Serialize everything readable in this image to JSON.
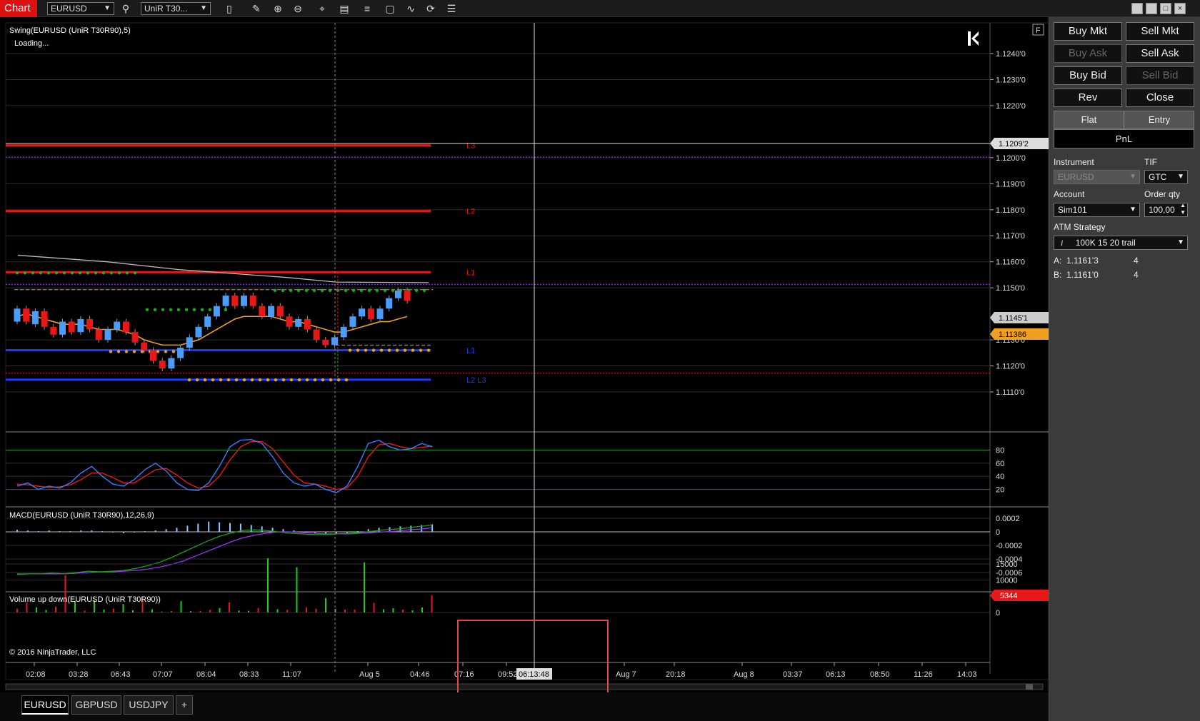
{
  "app": {
    "title": "Chart"
  },
  "toolbar": {
    "instrument": "EURUSD",
    "bar_type": "UniR T30..."
  },
  "window_controls": [
    "minimize-icon",
    "restore-icon",
    "maximize-icon",
    "close-icon"
  ],
  "indicators": {
    "swing": "Swing(EURUSD (UniR T30R90),5)",
    "loading": "Loading...",
    "macd": "MACD(EURUSD (UniR T30R90),12,26,9)",
    "volume": "Volume up down(EURUSD (UniR T30R90))",
    "copyright": "© 2016 NinjaTrader, LLC",
    "f_button": "F"
  },
  "price_axis": {
    "ticks": [
      "1.1240'0",
      "1.1230'0",
      "1.1220'0",
      "1.1200'0",
      "1.1190'0",
      "1.1180'0",
      "1.1170'0",
      "1.1160'0",
      "1.1150'0",
      "1.1130'0",
      "1.1120'0",
      "1.1110'0"
    ],
    "marker_crosshair": "1.1209'2",
    "marker_last": "1.1145'1",
    "marker_ma": "1.11386"
  },
  "level_labels": {
    "l3": "L3",
    "l2": "L2",
    "l1": "L1",
    "l1_low": "L1",
    "l2l3_low": "L2 L3"
  },
  "stoch_axis": [
    "80",
    "60",
    "40",
    "20"
  ],
  "macd_axis": [
    "0.0002",
    "0",
    "-0.0002",
    "-0.0004",
    "-0.0006"
  ],
  "volume_axis": [
    "15000",
    "10000",
    "0"
  ],
  "volume_marker": "5344",
  "time_axis": [
    "02:08",
    "03:28",
    "06:43",
    "07:07",
    "08:04",
    "08:33",
    "11:07",
    "Aug 5",
    "04:46",
    "07:16",
    "09:52",
    "06:13:48",
    "Aug 7",
    "20:18",
    "Aug 8",
    "03:37",
    "06:13",
    "08:50",
    "11:26",
    "14:03"
  ],
  "tabs": [
    "EURUSD",
    "GBPUSD",
    "USDJPY",
    "+"
  ],
  "colors": {
    "bull": "#4a9cff",
    "bear": "#e81818",
    "accent_red": "#d11",
    "ma": "#f0a020",
    "grid": "#333"
  },
  "order_panel": {
    "buy_mkt": "Buy Mkt",
    "sell_mkt": "Sell Mkt",
    "buy_ask": "Buy Ask",
    "sell_ask": "Sell Ask",
    "buy_bid": "Buy Bid",
    "sell_bid": "Sell Bid",
    "rev": "Rev",
    "close": "Close",
    "flat": "Flat",
    "entry": "Entry",
    "pnl": "PnL",
    "instrument_label": "Instrument",
    "instrument_value": "EURUSD",
    "tif_label": "TIF",
    "tif_value": "GTC",
    "account_label": "Account",
    "account_value": "Sim101",
    "order_qty_label": "Order qty",
    "order_qty_value": "100,00",
    "atm_label": "ATM Strategy",
    "atm_value": "100K 15 20 trail",
    "ask_label": "A:",
    "ask_price": "1.1161'3",
    "ask_size": "4",
    "bid_label": "B:",
    "bid_price": "1.1161'0",
    "bid_size": "4"
  },
  "chart_data": {
    "type": "candlestick",
    "candles": [
      {
        "o": 1.1137,
        "c": 1.1142
      },
      {
        "o": 1.1142,
        "c": 1.1137
      },
      {
        "o": 1.1136,
        "c": 1.1141
      },
      {
        "o": 1.1141,
        "c": 1.1135
      },
      {
        "o": 1.1135,
        "c": 1.1132
      },
      {
        "o": 1.1132,
        "c": 1.1137
      },
      {
        "o": 1.1137,
        "c": 1.1133
      },
      {
        "o": 1.1133,
        "c": 1.1138
      },
      {
        "o": 1.1138,
        "c": 1.1134
      },
      {
        "o": 1.1134,
        "c": 1.113
      },
      {
        "o": 1.113,
        "c": 1.1134
      },
      {
        "o": 1.1134,
        "c": 1.1137
      },
      {
        "o": 1.1137,
        "c": 1.1133
      },
      {
        "o": 1.1133,
        "c": 1.1129
      },
      {
        "o": 1.1129,
        "c": 1.1126
      },
      {
        "o": 1.1126,
        "c": 1.1122
      },
      {
        "o": 1.1122,
        "c": 1.1119
      },
      {
        "o": 1.1119,
        "c": 1.1123
      },
      {
        "o": 1.1123,
        "c": 1.1127
      },
      {
        "o": 1.1127,
        "c": 1.1131
      },
      {
        "o": 1.1131,
        "c": 1.1135
      },
      {
        "o": 1.1135,
        "c": 1.1139
      },
      {
        "o": 1.1139,
        "c": 1.1143
      },
      {
        "o": 1.1143,
        "c": 1.1147
      },
      {
        "o": 1.1147,
        "c": 1.1143
      },
      {
        "o": 1.1143,
        "c": 1.1147
      },
      {
        "o": 1.1147,
        "c": 1.1143
      },
      {
        "o": 1.1143,
        "c": 1.1139
      },
      {
        "o": 1.1139,
        "c": 1.1143
      },
      {
        "o": 1.1143,
        "c": 1.1139
      },
      {
        "o": 1.1139,
        "c": 1.1135
      },
      {
        "o": 1.1135,
        "c": 1.1138
      },
      {
        "o": 1.1138,
        "c": 1.1134
      },
      {
        "o": 1.1134,
        "c": 1.113
      },
      {
        "o": 1.113,
        "c": 1.1128
      },
      {
        "o": 1.1128,
        "c": 1.1131
      },
      {
        "o": 1.1131,
        "c": 1.1135
      },
      {
        "o": 1.1135,
        "c": 1.1139
      },
      {
        "o": 1.1139,
        "c": 1.1142
      },
      {
        "o": 1.1142,
        "c": 1.1138
      },
      {
        "o": 1.1138,
        "c": 1.1142
      },
      {
        "o": 1.1142,
        "c": 1.1146
      },
      {
        "o": 1.1146,
        "c": 1.1149
      },
      {
        "o": 1.1149,
        "c": 1.1145
      }
    ],
    "ma": [
      1.1139,
      1.114,
      1.1139,
      1.1138,
      1.1137,
      1.1136,
      1.1136,
      1.1136,
      1.1135,
      1.1134,
      1.1134,
      1.1134,
      1.1133,
      1.1132,
      1.113,
      1.1129,
      1.1128,
      1.1128,
      1.1128,
      1.1129,
      1.113,
      1.1132,
      1.1134,
      1.1136,
      1.1138,
      1.1139,
      1.1139,
      1.1139,
      1.1139,
      1.1138,
      1.1137,
      1.1137,
      1.1136,
      1.1135,
      1.1134,
      1.1133,
      1.1133,
      1.1134,
      1.1135,
      1.1136,
      1.1137,
      1.1137,
      1.1138,
      1.1139
    ],
    "levels": {
      "L3": 1.12047,
      "L2": 1.11795,
      "L1": 1.1156,
      "L1_low": 1.1126,
      "L2L3_low": 1.11147
    },
    "stoch_k": [
      25,
      30,
      20,
      25,
      22,
      30,
      45,
      55,
      40,
      28,
      25,
      35,
      50,
      60,
      48,
      30,
      20,
      18,
      30,
      55,
      85,
      95,
      96,
      90,
      70,
      45,
      30,
      25,
      28,
      20,
      15,
      25,
      55,
      90,
      95,
      85,
      80,
      82,
      90,
      85
    ],
    "stoch_d": [
      28,
      27,
      25,
      23,
      24,
      27,
      35,
      45,
      45,
      38,
      30,
      30,
      40,
      50,
      52,
      42,
      30,
      22,
      25,
      40,
      65,
      85,
      93,
      93,
      82,
      62,
      42,
      30,
      28,
      25,
      20,
      22,
      40,
      70,
      88,
      90,
      85,
      82,
      84,
      86
    ],
    "macd_hist": [
      3e-05,
      2e-05,
      1e-05,
      2e-05,
      1e-05,
      1e-05,
      2e-05,
      2e-05,
      1e-05,
      -1e-05,
      -2e-05,
      -1e-05,
      1e-05,
      2e-05,
      4e-05,
      6e-05,
      9e-05,
      0.00012,
      0.00015,
      0.00014,
      0.00013,
      0.00012,
      0.0001,
      8e-05,
      6e-05,
      4e-05,
      2e-05,
      -1e-05,
      -2e-05,
      -3e-05,
      -3e-05,
      -2e-05,
      1e-05,
      4e-05,
      6e-05,
      7e-05,
      8e-05,
      9e-05,
      0.0001,
      0.00011
    ],
    "volume": [
      1200,
      3000,
      1600,
      800,
      1800,
      11500,
      3600,
      600,
      3800,
      900,
      1200,
      2600,
      700,
      4800,
      1000,
      300,
      500,
      3500,
      400,
      500,
      800,
      1400,
      3100,
      600,
      500,
      1400,
      16800,
      1000,
      800,
      14000,
      1600,
      1200,
      4500,
      1100,
      900,
      900,
      15500,
      3000,
      1000,
      1300,
      900,
      700,
      1600,
      5344
    ]
  }
}
